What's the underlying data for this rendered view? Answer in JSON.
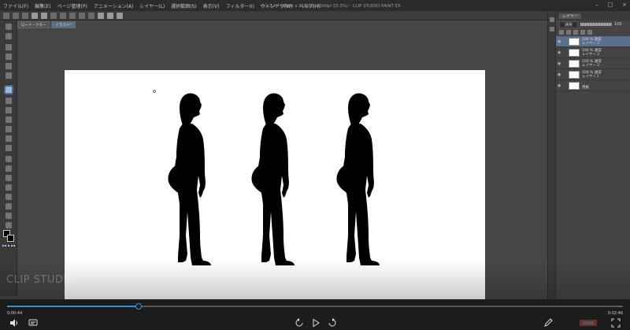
{
  "menu": {
    "items": [
      "ファイル(F)",
      "編集(E)",
      "ページ管理(P)",
      "アニメーション(A)",
      "レイヤー(L)",
      "選択範囲(S)",
      "表示(V)",
      "フィルター(I)",
      "ウィンドウ(W)",
      "ヘルプ(H)"
    ],
    "app_title": "イラスト* (3840 x 2160px 300dpi 33.3%) - CLIP STUDIO PAINT EX"
  },
  "tabs": [
    {
      "label": "ロード・クター"
    },
    {
      "label": "イラスト*"
    }
  ],
  "layers_panel": {
    "tab_label": "レイヤー",
    "blend_mode": "通常",
    "opacity_value": "100",
    "layers": [
      {
        "line1": "100 % 通常",
        "line2": "レイヤー 2",
        "selected": true
      },
      {
        "line1": "100 % 通常",
        "line2": "レイヤー 2",
        "selected": false
      },
      {
        "line1": "100 % 通常",
        "line2": "レイヤー 2",
        "selected": false
      },
      {
        "line1": "100 % 通常",
        "line2": "レイヤー 1",
        "selected": false
      },
      {
        "line1": "",
        "line2": "用紙",
        "selected": false
      }
    ]
  },
  "watermark": "CLIP STUDIO",
  "player": {
    "current_time": "0:00:44",
    "total_time": "0:02:46",
    "progress": 0.214,
    "accent_color": "#3a8fd6",
    "buttons": [
      "volume-icon",
      "subtitles-icon",
      "rewind-icon",
      "play-icon",
      "forward-icon",
      "pen-icon",
      "fullscreen-icon"
    ]
  },
  "canvas": {
    "background": "#ffffff",
    "figure_count": 3
  }
}
